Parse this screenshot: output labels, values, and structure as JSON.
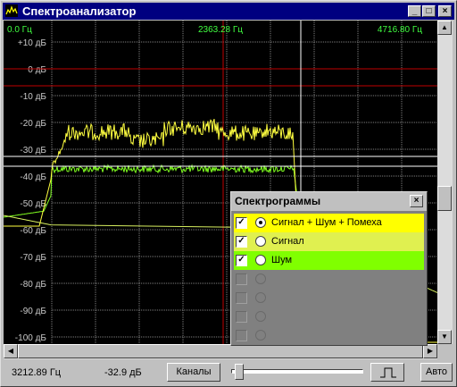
{
  "window": {
    "title": "Спектроанализатор",
    "buttons": [
      "_",
      "□",
      "×"
    ]
  },
  "plot": {
    "freq_labels": [
      "0.0 Гц",
      "2363.28 Гц",
      "4716.80 Гц"
    ],
    "y_labels": [
      "+10 дБ",
      "0 дБ",
      "-10 дБ",
      "-20 дБ",
      "-30 дБ",
      "-40 дБ",
      "-50 дБ",
      "-60 дБ",
      "-70 дБ",
      "-80 дБ",
      "-90 дБ",
      "-100 дБ"
    ],
    "colors": {
      "signal_noise_interference": "#ffff40",
      "signal": "#d8f060",
      "noise": "#80ff20",
      "grid": "#808080",
      "red_line": "#c00000",
      "cursor": "#ffffff"
    }
  },
  "status": {
    "frequency": "3212.89 Гц",
    "level": "-32.9 дБ",
    "channels_button": "Каналы",
    "auto_button": "Авто",
    "toggle_button": ""
  },
  "popup": {
    "title": "Спектрограммы",
    "rows": [
      {
        "label": "Сигнал + Шум + Помеха",
        "checked": true,
        "selected": true,
        "color": "#ffff00"
      },
      {
        "label": "Сигнал",
        "checked": true,
        "selected": false,
        "color": "#e0f050"
      },
      {
        "label": "Шум",
        "checked": true,
        "selected": false,
        "color": "#80ff00"
      },
      {
        "label": "",
        "checked": false,
        "selected": false,
        "color": ""
      },
      {
        "label": "",
        "checked": false,
        "selected": false,
        "color": ""
      },
      {
        "label": "",
        "checked": false,
        "selected": false,
        "color": ""
      },
      {
        "label": "",
        "checked": false,
        "selected": false,
        "color": ""
      }
    ]
  }
}
